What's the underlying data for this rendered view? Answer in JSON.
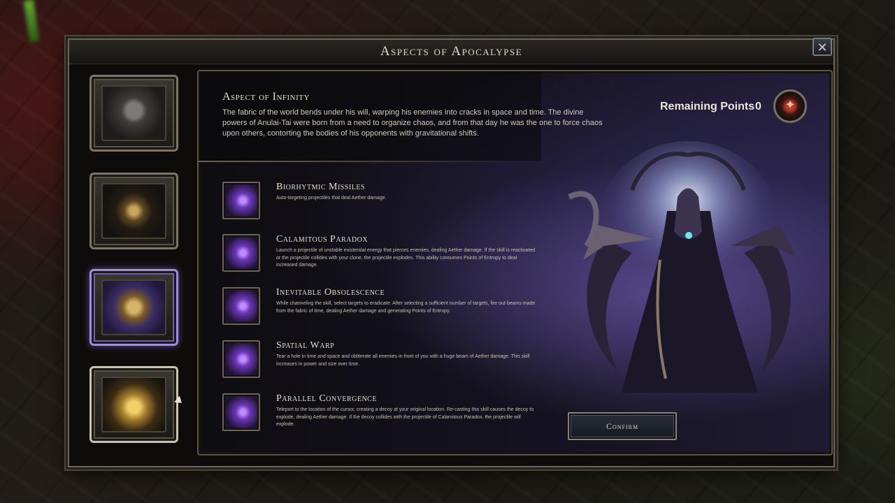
{
  "window": {
    "title": "Aspects of Apocalypse",
    "close_icon": "✕"
  },
  "aspects": [
    {
      "name": "aspect-1",
      "state": "default"
    },
    {
      "name": "aspect-2",
      "state": "default"
    },
    {
      "name": "aspect-3",
      "state": "highlighted"
    },
    {
      "name": "aspect-4",
      "state": "selected"
    }
  ],
  "selected_aspect": {
    "title": "Aspect of Infinity",
    "description": "The fabric of the world bends under his will, warping his enemies into cracks in space and time. The divine powers of Anulai-Tai were born from a need to organize chaos, and from that day he was the one to force chaos upon others, contorting the bodies of his opponents with gravitational shifts."
  },
  "points": {
    "label": "Remaining Points",
    "value": "0"
  },
  "skills": [
    {
      "name": "Biorhytmic Missiles",
      "text": "Auto-targeting projectiles that deal Aether damage."
    },
    {
      "name": "Calamitous Paradox",
      "text": "Launch a projectile of unstable existential energy that pierces enemies, dealing Aether damage. If the skill is reactivated or the projectile collides with your clone, the projectile explodes. This ability consumes Points of Entropy to deal increased damage."
    },
    {
      "name": "Inevitable Obsolescence",
      "text": "While channeling the skill, select targets to eradicate. After selecting a sufficient number of targets, fire out beams made from the fabric of time, dealing Aether damage and generating Points of Entropy."
    },
    {
      "name": "Spatial Warp",
      "text": "Tear a hole in time and space and obliterate all enemies in front of you with a huge beam of Aether damage. This skill increases in power and size over time."
    },
    {
      "name": "Parallel Convergence",
      "text": "Teleport to the location of the cursor, creating a decoy at your original location. Re-casting this skill causes the decoy to explode, dealing Aether damage. If the decoy collides with the projectile of Calamitous Paradox, the projectile will explode."
    }
  ],
  "confirm_label": "Confirm",
  "colors": {
    "accent_purple": "#9e8fd6",
    "frame": "#6d6457",
    "text": "#e6e0d1"
  }
}
